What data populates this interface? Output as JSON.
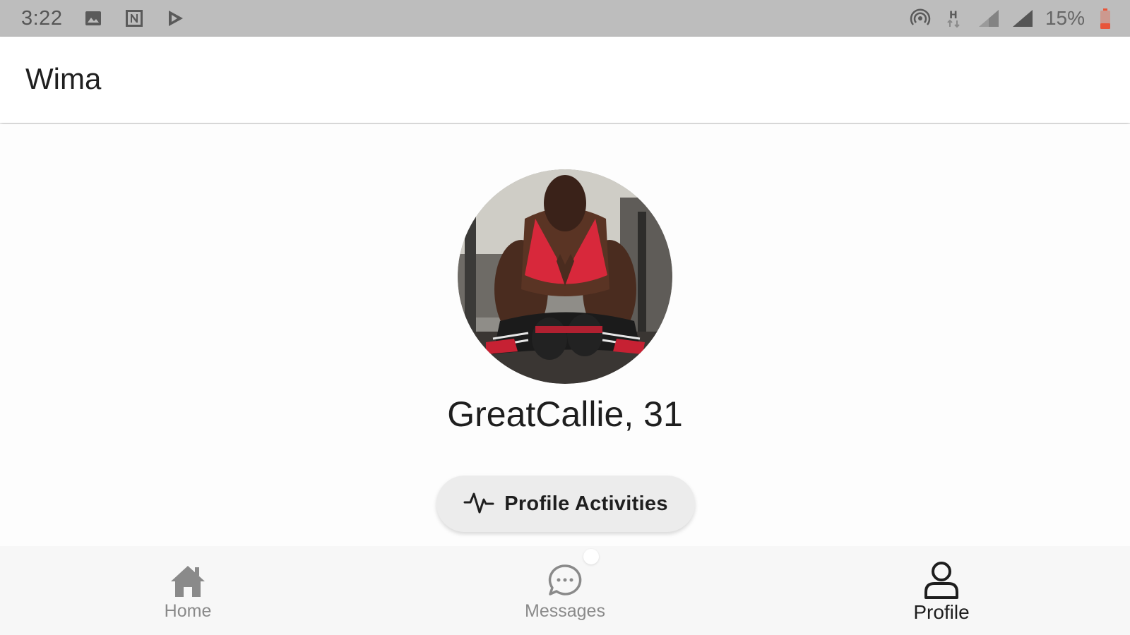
{
  "status_bar": {
    "time": "3:22",
    "left_icons": [
      "image-icon",
      "notion-icon",
      "play-store-icon"
    ],
    "right_icons": [
      "hotspot-icon",
      "data-h-icon",
      "signal-1-icon",
      "signal-2-icon"
    ],
    "battery_text": "15%",
    "battery_color": "#e8553a"
  },
  "app_bar": {
    "title": "Wima"
  },
  "profile": {
    "name_age": "GreatCallie, 31",
    "activities_button_label": "Profile Activities"
  },
  "bottom_nav": {
    "items": [
      {
        "label": "Home",
        "icon": "home-icon",
        "active": false
      },
      {
        "label": "Messages",
        "icon": "chat-bubble-icon",
        "active": false
      },
      {
        "label": "Profile",
        "icon": "person-icon",
        "active": true
      }
    ]
  },
  "colors": {
    "status_bar_bg": "#bdbdbd",
    "app_bar_bg": "#ffffff",
    "button_bg": "#ececec",
    "nav_inactive": "#8a8a8a",
    "nav_active": "#1e1e1e"
  }
}
